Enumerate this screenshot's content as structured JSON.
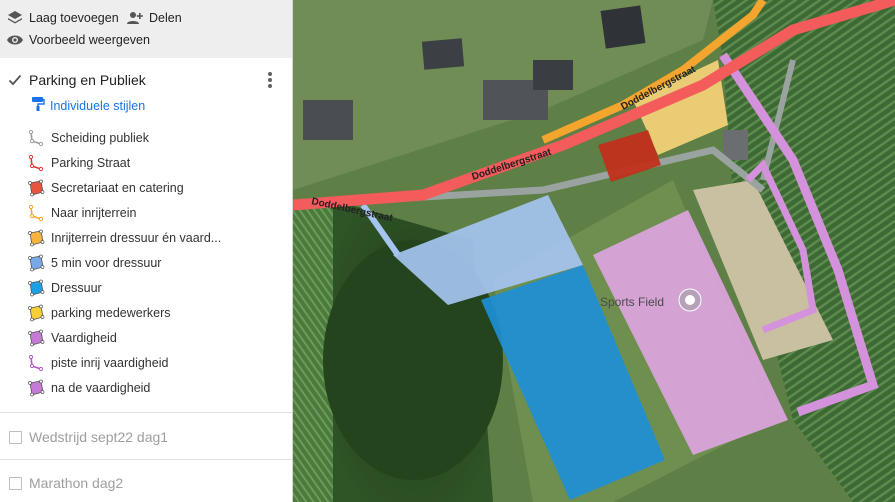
{
  "toolbar": {
    "add_layer_label": "Laag toevoegen",
    "share_label": "Delen",
    "preview_label": "Voorbeeld weergeven"
  },
  "layer": {
    "title": "Parking en Publiek",
    "checked": true,
    "styles_label": "Individuele stijlen",
    "items": [
      {
        "label": "Scheiding publiek",
        "type": "line",
        "color": "#9e9e9e"
      },
      {
        "label": "Parking Straat",
        "type": "line",
        "color": "#e53935"
      },
      {
        "label": "Secretariaat en catering",
        "type": "polygon",
        "color": "#e8553f"
      },
      {
        "label": "Naar inrijterrein",
        "type": "line",
        "color": "#f9a825"
      },
      {
        "label": "Inrijterrein dressuur én vaard...",
        "type": "polygon",
        "color": "#f6b33e"
      },
      {
        "label": "5 min voor dressuur",
        "type": "polygon",
        "color": "#7aa7e8"
      },
      {
        "label": "Dressuur",
        "type": "polygon",
        "color": "#1ea0e6"
      },
      {
        "label": "parking medewerkers",
        "type": "polygon",
        "color": "#f5cf35"
      },
      {
        "label": "Vaardigheid",
        "type": "polygon",
        "color": "#c57ad6"
      },
      {
        "label": "piste inrij vaardigheid",
        "type": "line",
        "color": "#b45ac7"
      },
      {
        "label": "na de vaardigheid",
        "type": "polygon",
        "color": "#c57ad6"
      }
    ]
  },
  "other_layers": [
    {
      "title": "Wedstrijd sept22 dag1",
      "checked": false
    },
    {
      "title": "Marathon dag2",
      "checked": false
    }
  ],
  "map": {
    "street_label": "Doddelbergstraat",
    "poi_label": "Sports Field"
  }
}
